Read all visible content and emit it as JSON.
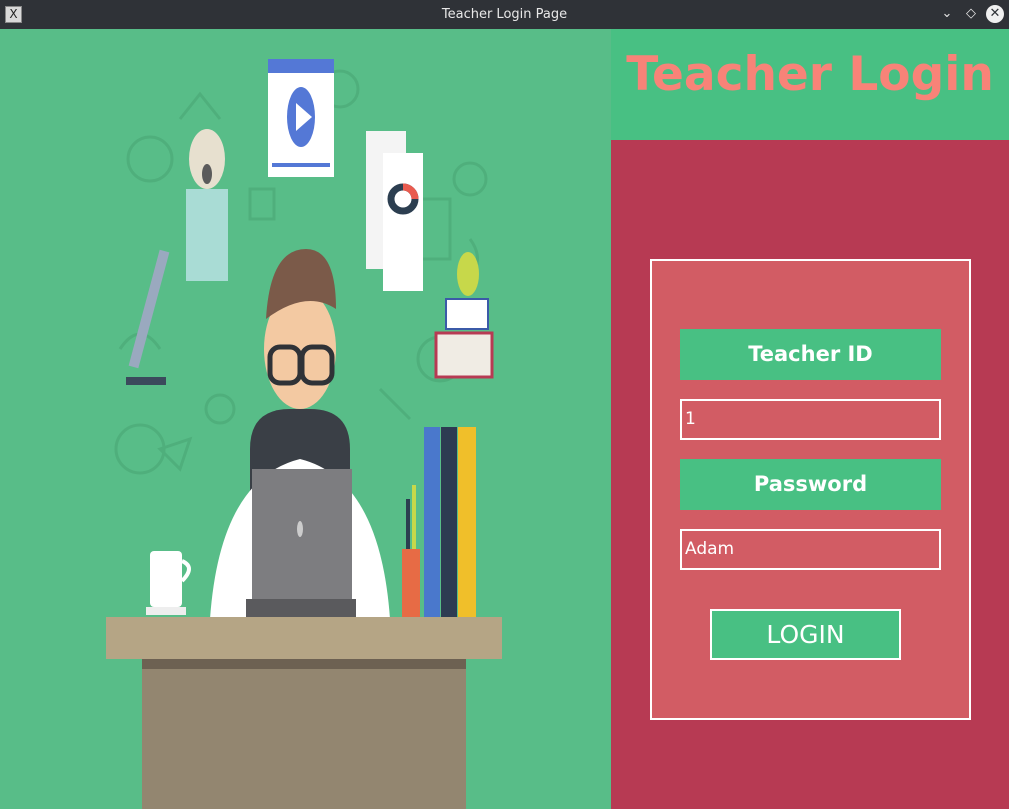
{
  "window": {
    "title": "Teacher Login Page",
    "app_icon_glyph": "X",
    "minimize_glyph": "⌄",
    "maximize_glyph": "◇",
    "close_glyph": "✕"
  },
  "header": {
    "title": "Teacher Login"
  },
  "form": {
    "teacher_id_label": "Teacher ID",
    "teacher_id_value": "1",
    "password_label": "Password",
    "password_value": "Adam",
    "login_button": "LOGIN"
  },
  "colors": {
    "header_bg": "#48c083",
    "header_text": "#f88378",
    "panel_bg": "#b73a53",
    "form_bg": "#d25c64",
    "accent_green": "#48c083",
    "illustration_bg": "#58bd88"
  },
  "icons": {
    "illustration": "teacher-at-desk-illustration"
  }
}
